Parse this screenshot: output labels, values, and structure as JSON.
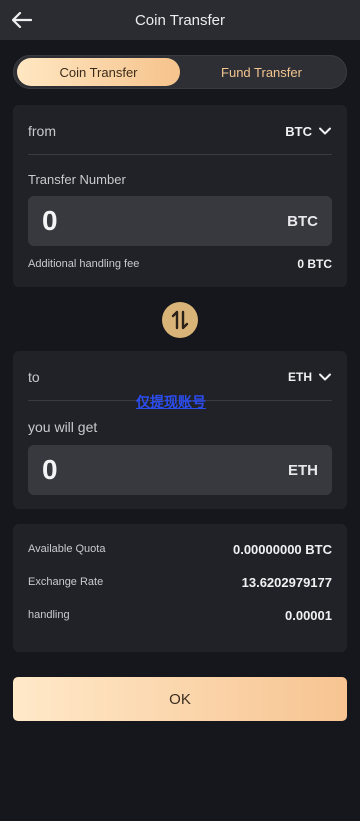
{
  "header": {
    "title": "Coin Transfer",
    "back_icon": "arrow-left-icon"
  },
  "tabs": [
    {
      "label": "Coin Transfer",
      "active": true
    },
    {
      "label": "Fund Transfer",
      "active": false
    }
  ],
  "from": {
    "label": "from",
    "currency": "BTC",
    "transfer_number_label": "Transfer Number",
    "amount": "0",
    "amount_unit": "BTC",
    "fee_label": "Additional handling fee",
    "fee_value": "0 BTC"
  },
  "to": {
    "label": "to",
    "currency": "ETH",
    "overlay_link": "仅提现账号",
    "get_label": "you will get",
    "amount": "0",
    "amount_unit": "ETH"
  },
  "info": {
    "quota_label": "Available Quota",
    "quota_value": "0.00000000 BTC",
    "rate_label": "Exchange Rate",
    "rate_value": "13.6202979177",
    "handling_label": "handling",
    "handling_value": "0.00001"
  },
  "ok_button": "OK",
  "colors": {
    "background": "#16171c",
    "card": "#212227",
    "accent_gold": "#f6c38c",
    "swap_gold": "#d8b478",
    "link_blue": "#2b4df0"
  }
}
